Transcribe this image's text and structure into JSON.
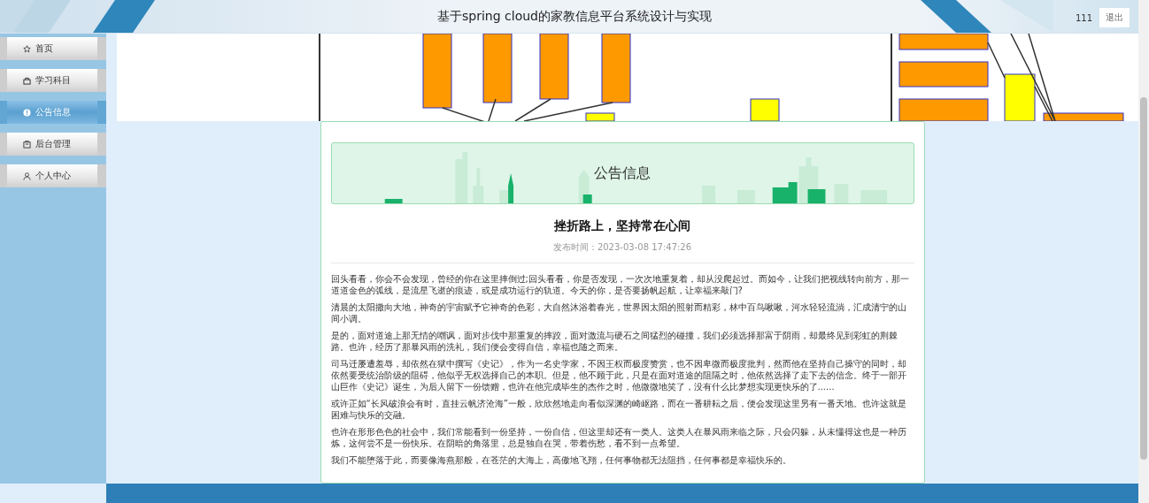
{
  "header": {
    "title": "基于spring cloud的家教信息平台系统设计与实现",
    "user": "111",
    "logout": "退出"
  },
  "sidebar": {
    "items": [
      {
        "label": "首页",
        "kind": "star",
        "selected": false
      },
      {
        "label": "学习科目",
        "kind": "bag",
        "selected": false
      },
      {
        "label": "公告信息",
        "kind": "alert",
        "selected": true
      },
      {
        "label": "后台管理",
        "kind": "box",
        "selected": false
      },
      {
        "label": "个人中心",
        "kind": "person",
        "selected": false
      }
    ]
  },
  "notice": {
    "section_title": "公告信息",
    "title": "挫折路上，坚持常在心间",
    "published": "发布时间：2023-03-08 17:47:26",
    "paragraphs": [
      "回头看看，你会不会发现，曾经的你在这里摔倒过;回头看看，你是否发现，一次次地重复着，却从没爬起过。而如今，让我们把视线转向前方，那一道道金色的弧线，是流星飞逝的痕迹，或是成功运行的轨道。今天的你，是否要扬帆起航，让幸福来敲门?",
      "清晨的太阳撒向大地，神奇的宇宙赋予它神奇的色彩，大自然沐浴着春光，世界因太阳的照射而精彩，林中百鸟啾啾，河水轻轻流淌，汇成清宁的山间小调。",
      "是的，面对道途上那无情的嘲讽，面对步伐中那重复的摔跤，面对激流与硬石之间猛烈的碰撞，我们必须选择那富于阴雨，却最终见到彩虹的荆棘路。也许，经历了那暴风雨的洗礼，我们便会变得自信，幸福也随之而来。",
      "司马迁屡遭羞辱，却依然在狱中撰写《史记》，作为一名史学家，不因王权而极度赞赏，也不因卑微而极度批判，然而他在坚持自己操守的同时，却依然要受统治阶级的阻碍，他似乎无权选择自己的本职。但是，他不顾于此，只是在面对道途的阻隔之时，他依然选择了走下去的信念。终于一部开山巨作《史记》诞生，为后人留下一份馈赠，也许在他完成毕生的杰作之时，他微微地笑了，没有什么比梦想实现更快乐的了......",
      "或许正如“长风破浪会有时，直挂云帆济沧海”一般，欣欣然地走向看似深渊的崎岖路，而在一番耕耘之后，便会发现这里另有一番天地。也许这就是困难与快乐的交融。",
      "也许在形形色色的社会中，我们常能看到一份坚持，一份自信，但这里却还有一类人。这类人在暴风雨来临之际，只会闪躲，从未懂得这也是一种历炼，这何尝不是一份快乐。在阴暗的角落里，总是独自在哭，带着伤愁，看不到一点希望。",
      "我们不能堕落于此，而要像海燕那般，在苍茫的大海上，高傲地飞翔，任何事物都无法阻挡，任何事都是幸福快乐的。"
    ]
  }
}
